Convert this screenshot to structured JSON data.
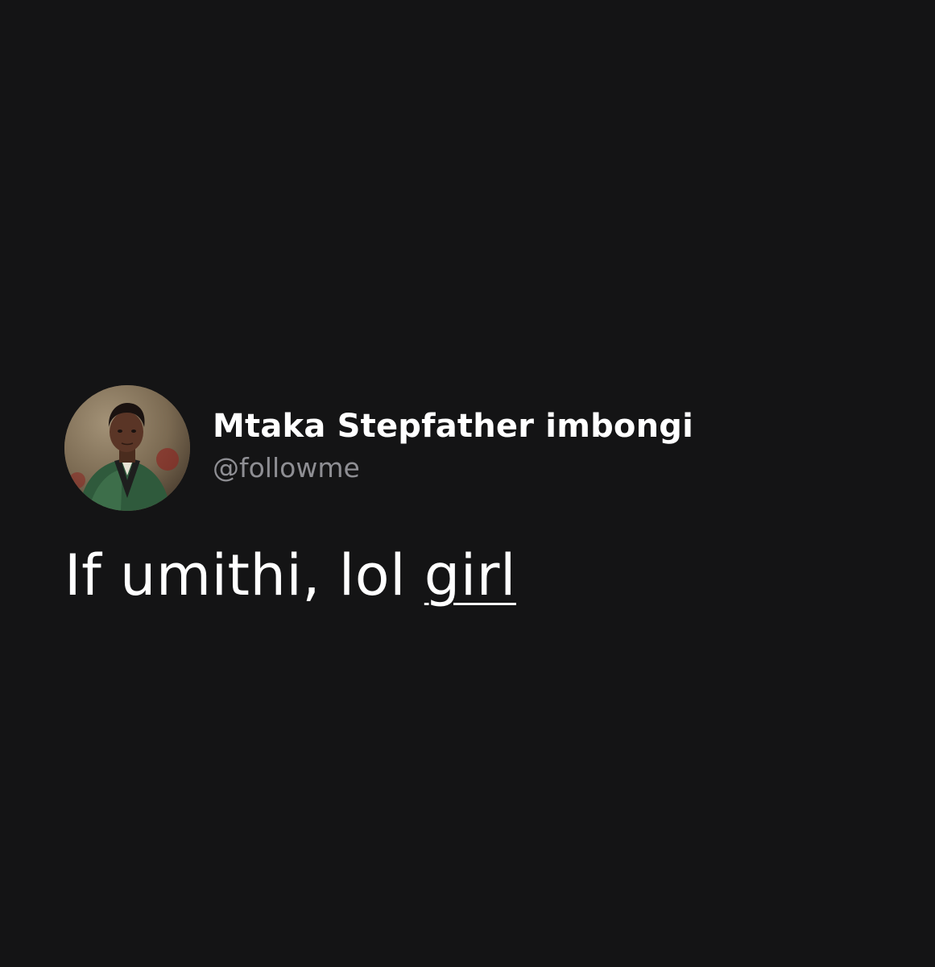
{
  "post": {
    "author": {
      "display_name": "Mtaka Stepfather imbongi",
      "handle": "@followme"
    },
    "text_plain": "If umithi, lol ",
    "text_link": "girl"
  },
  "colors": {
    "background": "#141415",
    "text_primary": "#ffffff",
    "text_secondary": "#8e8e93"
  }
}
